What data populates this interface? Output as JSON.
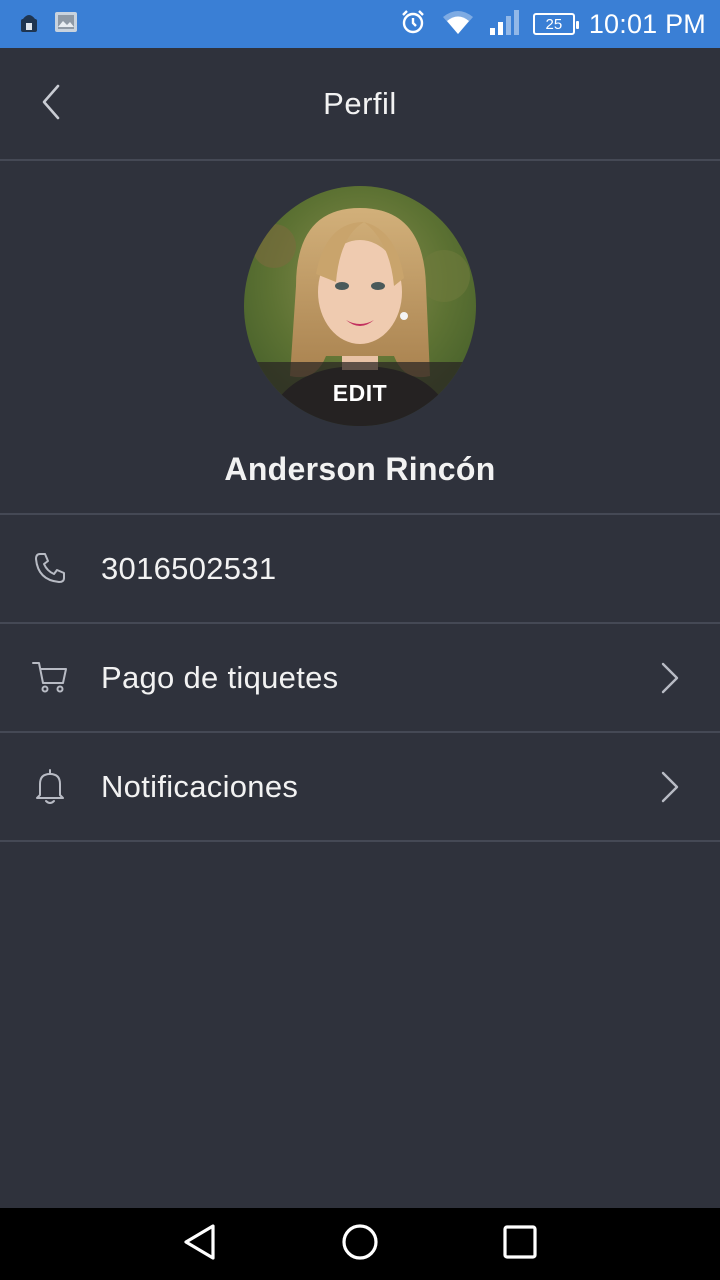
{
  "status_bar": {
    "time": "10:01 PM",
    "battery_level": "25",
    "left_icons": [
      "android-debug-icon",
      "image-notification-icon"
    ],
    "right_icons": [
      "alarm-icon",
      "wifi-icon",
      "signal-icon",
      "battery-icon"
    ]
  },
  "header": {
    "title": "Perfil",
    "back_icon": "chevron-left-icon"
  },
  "profile": {
    "edit_label": "EDIT",
    "name": "Anderson Rincón"
  },
  "rows": [
    {
      "icon": "phone-icon",
      "label": "3016502531",
      "has_chevron": false
    },
    {
      "icon": "cart-icon",
      "label": "Pago de tiquetes",
      "has_chevron": true
    },
    {
      "icon": "bell-icon",
      "label": "Notificaciones",
      "has_chevron": true
    }
  ],
  "nav_bar": {
    "buttons": [
      "back-triangle-icon",
      "home-circle-icon",
      "recents-square-icon"
    ]
  },
  "colors": {
    "status_bar": "#3a7fd5",
    "background": "#2f323c",
    "divider": "#454955",
    "text": "#f2f2f2",
    "icon": "#b8bbc4"
  }
}
